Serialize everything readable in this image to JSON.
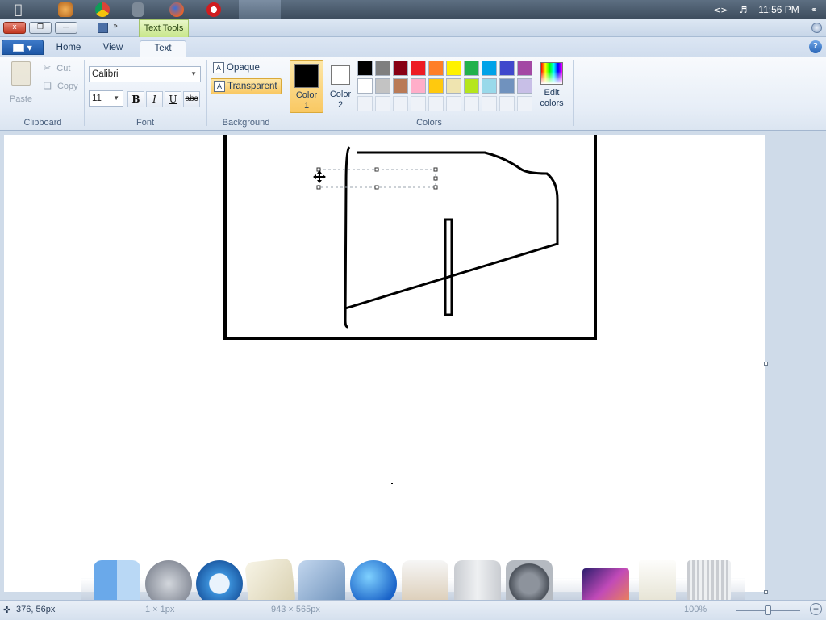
{
  "menubar": {
    "apple_icon": "apple-icon",
    "apps": [
      "media-player-icon",
      "chrome-icon",
      "file-icon",
      "firefox-icon",
      "opera-icon",
      "chrome-icon"
    ],
    "clock": "11:56 PM"
  },
  "titlebar": {
    "close_label": "x",
    "contextual_tab": "Text Tools"
  },
  "tabs": {
    "file_label": "",
    "home": "Home",
    "view": "View",
    "text": "Text"
  },
  "clipboard": {
    "paste": "Paste",
    "cut": "Cut",
    "copy": "Copy",
    "label": "Clipboard"
  },
  "font": {
    "family": "Calibri",
    "size": "11",
    "bold": "B",
    "italic": "I",
    "underline": "U",
    "strikethrough": "abc",
    "label": "Font"
  },
  "background": {
    "opaque": "Opaque",
    "transparent": "Transparent",
    "selected": "Transparent",
    "label": "Background"
  },
  "colors": {
    "color1_label": "Color",
    "color1_num": "1",
    "color2_label": "Color",
    "color2_num": "2",
    "color1": "#000000",
    "color2": "#ffffff",
    "edit_label": "Edit",
    "edit_label2": "colors",
    "label": "Colors",
    "palette_row1": [
      "#000000",
      "#7f7f7f",
      "#880015",
      "#ed1c24",
      "#ff7f27",
      "#fff200",
      "#22b14c",
      "#00a2e8",
      "#3f48cc",
      "#a349a4"
    ],
    "palette_row2": [
      "#ffffff",
      "#c3c3c3",
      "#b97a57",
      "#ffaec9",
      "#ffc90e",
      "#efe4b0",
      "#b5e61d",
      "#99d9ea",
      "#7092be",
      "#c8bfe7"
    ]
  },
  "status": {
    "cursor_pos": "376, 56px",
    "selection_size": "1 × 1px",
    "canvas_size": "943 × 565px",
    "zoom": "100%"
  }
}
